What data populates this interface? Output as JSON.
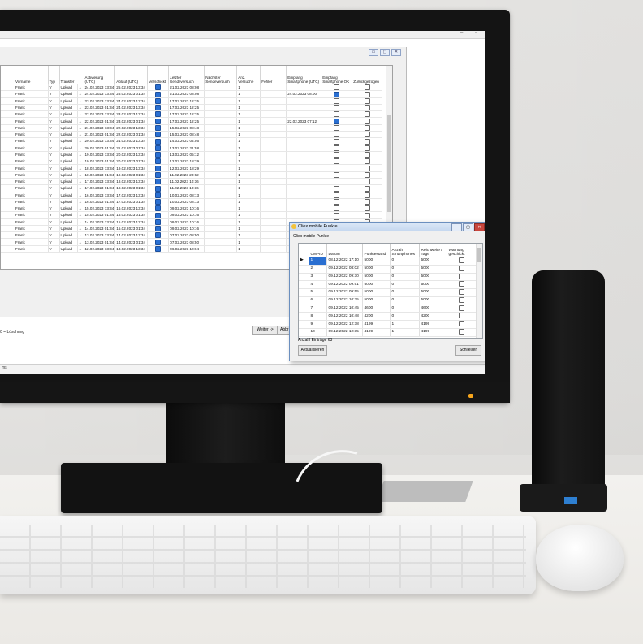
{
  "main_grid": {
    "columns": [
      "Vorname",
      "Typ",
      "Transfer",
      "Aktivierung (UTC)",
      "Ablauf (UTC)",
      "Verschickt",
      "Letzter Sendeversuch",
      "Nächster Sendeversuch",
      "Anz. Versuche",
      "Fehler",
      "Empfang Smartphone (UTC)",
      "Empfang Smartphone OK",
      "Zurückgezogen"
    ],
    "rows": [
      {
        "vorname": "Frank",
        "typ": "V",
        "transfer": "Upload",
        "akt": "24.02.2023 13:34",
        "ablauf": "25.02.2023 13:34",
        "letzter": "21.02.2023 08:08",
        "anz": "1",
        "empfang": "",
        "ok": false
      },
      {
        "vorname": "Frank",
        "typ": "V",
        "transfer": "Upload",
        "akt": "24.02.2023 13:34",
        "ablauf": "25.02.2023 01:34",
        "letzter": "21.02.2023 08:08",
        "anz": "1",
        "empfang": "24.02.2023 08:00",
        "ok": true
      },
      {
        "vorname": "Frank",
        "typ": "V",
        "transfer": "Upload",
        "akt": "23.02.2023 13:34",
        "ablauf": "24.02.2023 13:34",
        "letzter": "17.02.2023 12:25",
        "anz": "1",
        "empfang": "",
        "ok": false
      },
      {
        "vorname": "Frank",
        "typ": "V",
        "transfer": "Upload",
        "akt": "23.02.2023 01:34",
        "ablauf": "24.02.2023 13:34",
        "letzter": "17.02.2023 12:25",
        "anz": "1",
        "empfang": "",
        "ok": false
      },
      {
        "vorname": "Frank",
        "typ": "V",
        "transfer": "Upload",
        "akt": "22.02.2023 13:34",
        "ablauf": "23.02.2023 13:34",
        "letzter": "17.02.2023 12:25",
        "anz": "1",
        "empfang": "",
        "ok": false
      },
      {
        "vorname": "Frank",
        "typ": "V",
        "transfer": "Upload",
        "akt": "22.02.2023 01:34",
        "ablauf": "23.02.2023 01:34",
        "letzter": "17.02.2023 12:25",
        "anz": "1",
        "empfang": "22.02.2023 07:12",
        "ok": true
      },
      {
        "vorname": "Frank",
        "typ": "V",
        "transfer": "Upload",
        "akt": "21.02.2023 13:34",
        "ablauf": "22.02.2023 13:34",
        "letzter": "15.02.2023 08:48",
        "anz": "1",
        "empfang": "",
        "ok": false
      },
      {
        "vorname": "Frank",
        "typ": "V",
        "transfer": "Upload",
        "akt": "21.02.2023 01:34",
        "ablauf": "22.02.2023 01:34",
        "letzter": "15.02.2023 08:48",
        "anz": "1",
        "empfang": "",
        "ok": false
      },
      {
        "vorname": "Frank",
        "typ": "V",
        "transfer": "Upload",
        "akt": "20.02.2023 13:34",
        "ablauf": "21.02.2023 13:34",
        "letzter": "14.02.2023 04:56",
        "anz": "1",
        "empfang": "",
        "ok": false
      },
      {
        "vorname": "Frank",
        "typ": "V",
        "transfer": "Upload",
        "akt": "20.02.2023 01:34",
        "ablauf": "21.02.2023 01:34",
        "letzter": "13.02.2023 21:58",
        "anz": "1",
        "empfang": "",
        "ok": false
      },
      {
        "vorname": "Frank",
        "typ": "V",
        "transfer": "Upload",
        "akt": "19.02.2023 13:34",
        "ablauf": "20.02.2023 13:34",
        "letzter": "13.02.2023 05:12",
        "anz": "1",
        "empfang": "",
        "ok": false
      },
      {
        "vorname": "Frank",
        "typ": "V",
        "transfer": "Upload",
        "akt": "19.02.2023 01:34",
        "ablauf": "20.02.2023 01:34",
        "letzter": "12.02.2023 18:29",
        "anz": "1",
        "empfang": "",
        "ok": false
      },
      {
        "vorname": "Frank",
        "typ": "V",
        "transfer": "Upload",
        "akt": "18.02.2023 13:34",
        "ablauf": "19.02.2023 13:34",
        "letzter": "12.02.2023 18:29",
        "anz": "1",
        "empfang": "",
        "ok": false
      },
      {
        "vorname": "Frank",
        "typ": "V",
        "transfer": "Upload",
        "akt": "18.02.2023 01:34",
        "ablauf": "19.02.2023 01:34",
        "letzter": "11.02.2023 20:02",
        "anz": "1",
        "empfang": "",
        "ok": false
      },
      {
        "vorname": "Frank",
        "typ": "V",
        "transfer": "Upload",
        "akt": "17.02.2023 13:34",
        "ablauf": "18.02.2023 13:34",
        "letzter": "11.02.2023 10:36",
        "anz": "1",
        "empfang": "",
        "ok": false
      },
      {
        "vorname": "Frank",
        "typ": "V",
        "transfer": "Upload",
        "akt": "17.02.2023 01:34",
        "ablauf": "18.02.2023 01:34",
        "letzter": "11.02.2023 10:36",
        "anz": "1",
        "empfang": "",
        "ok": false
      },
      {
        "vorname": "Frank",
        "typ": "V",
        "transfer": "Upload",
        "akt": "16.02.2023 13:34",
        "ablauf": "17.02.2023 13:34",
        "letzter": "10.02.2023 08:13",
        "anz": "1",
        "empfang": "",
        "ok": false
      },
      {
        "vorname": "Frank",
        "typ": "V",
        "transfer": "Upload",
        "akt": "16.02.2023 01:34",
        "ablauf": "17.02.2023 01:34",
        "letzter": "10.02.2023 08:13",
        "anz": "1",
        "empfang": "",
        "ok": false
      },
      {
        "vorname": "Frank",
        "typ": "V",
        "transfer": "Upload",
        "akt": "15.02.2023 13:34",
        "ablauf": "16.02.2023 13:34",
        "letzter": "09.02.2023 10:16",
        "anz": "1",
        "empfang": "",
        "ok": false
      },
      {
        "vorname": "Frank",
        "typ": "V",
        "transfer": "Upload",
        "akt": "15.02.2023 01:34",
        "ablauf": "16.02.2023 01:34",
        "letzter": "09.02.2023 10:16",
        "anz": "1",
        "empfang": "",
        "ok": false
      },
      {
        "vorname": "Frank",
        "typ": "V",
        "transfer": "Upload",
        "akt": "14.02.2023 13:34",
        "ablauf": "15.02.2023 13:34",
        "letzter": "09.02.2023 10:16",
        "anz": "1",
        "empfang": "",
        "ok": false
      },
      {
        "vorname": "Frank",
        "typ": "V",
        "transfer": "Upload",
        "akt": "14.02.2023 01:34",
        "ablauf": "15.02.2023 01:34",
        "letzter": "09.02.2023 10:16",
        "anz": "1",
        "empfang": "",
        "ok": false
      },
      {
        "vorname": "Frank",
        "typ": "V",
        "transfer": "Upload",
        "akt": "13.02.2023 13:34",
        "ablauf": "14.02.2023 13:34",
        "letzter": "07.02.2023 08:50",
        "anz": "1",
        "empfang": "",
        "ok": false
      },
      {
        "vorname": "Frank",
        "typ": "V",
        "transfer": "Upload",
        "akt": "13.02.2023 01:34",
        "ablauf": "14.02.2023 01:34",
        "letzter": "07.02.2023 08:50",
        "anz": "1",
        "empfang": "",
        "ok": false
      },
      {
        "vorname": "Frank",
        "typ": "V",
        "transfer": "Upload",
        "akt": "12.02.2023 13:34",
        "ablauf": "13.02.2023 13:34",
        "letzter": "06.02.2023 10:04",
        "anz": "1",
        "empfang": "",
        "ok": false
      }
    ],
    "transfer_marker": "→"
  },
  "legend_text": "0 = Löschung",
  "buttons": {
    "weiter": "Weiter ->",
    "abbrechen": "Abbr"
  },
  "taskbar_text": "ms",
  "dialog": {
    "title": "Cliex mobile Punkte",
    "tab_label": "Cliex mobile Punkte",
    "columns": [
      "CMPID",
      "Datum",
      "Punktestand",
      "Anzahl Smartphones",
      "Reichweite / Tage",
      "Warnung geschickt"
    ],
    "rows": [
      {
        "id": "1",
        "datum": "08.12.2022 17:10",
        "punkte": "5000",
        "anz": "0",
        "reich": "5000"
      },
      {
        "id": "2",
        "datum": "09.12.2022 08:02",
        "punkte": "5000",
        "anz": "0",
        "reich": "5000"
      },
      {
        "id": "3",
        "datum": "09.12.2022 09:30",
        "punkte": "5000",
        "anz": "0",
        "reich": "5000"
      },
      {
        "id": "4",
        "datum": "09.12.2022 09:51",
        "punkte": "5000",
        "anz": "0",
        "reich": "5000"
      },
      {
        "id": "5",
        "datum": "09.12.2022 09:55",
        "punkte": "5000",
        "anz": "0",
        "reich": "5000"
      },
      {
        "id": "6",
        "datum": "09.12.2022 10:35",
        "punkte": "5000",
        "anz": "0",
        "reich": "5000"
      },
      {
        "id": "7",
        "datum": "09.12.2022 10:45",
        "punkte": "4600",
        "anz": "0",
        "reich": "4600"
      },
      {
        "id": "8",
        "datum": "09.12.2022 10:48",
        "punkte": "4200",
        "anz": "0",
        "reich": "4200"
      },
      {
        "id": "9",
        "datum": "09.12.2022 12:38",
        "punkte": "4199",
        "anz": "1",
        "reich": "4199"
      },
      {
        "id": "10",
        "datum": "09.12.2022 12:35",
        "punkte": "4199",
        "anz": "1",
        "reich": "4199"
      }
    ],
    "row_marker": "▶",
    "count_text": "Anzahl Einträge 63",
    "refresh_label": "Aktualisieren",
    "close_label": "Schließen"
  },
  "colors": {
    "selection_blue": "#2a6fd1",
    "power_led": "#f7a51c"
  }
}
